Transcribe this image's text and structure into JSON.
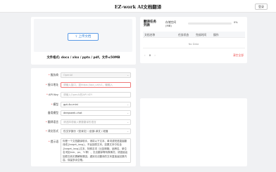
{
  "header": {
    "title": "EZ-work AI文档翻译",
    "login_label": "登录"
  },
  "upload": {
    "button_label": "上传文档",
    "formats_text": "文件格式: docx / xlsx / pptx / pdf，文件≤50MB"
  },
  "form": {
    "server": {
      "label": "服务商",
      "placeholder": "OpenAI"
    },
    "api_url": {
      "label": "接口地址",
      "placeholder": "请输入接口，如https://api_url/v1，输输入",
      "error_hint": "请输入接口地址"
    },
    "api_key": {
      "label": "API Key",
      "placeholder": "请输入OpenAI的API KEY"
    },
    "model": {
      "label": "模型",
      "value": "gpt-4o-mini"
    },
    "backup_model": {
      "label": "备用模型",
      "value": "deepseek-chat"
    },
    "target_lang": {
      "label": "翻译语言",
      "placeholder": "请选择或输入需要翻译的语言"
    },
    "output_format": {
      "label": "译文形式",
      "value": "仅文字部分（仅译文）/全部-译文 / 段落"
    },
    "prompt": {
      "label": "提示语",
      "value": "你是一个文档翻译助手，请将以下文本、单词或短语直接翻译成{target_lang}，不返回原文本。如果文本中包含{target_lang}文本、特殊名词（比如邮箱、品牌名、单位名词如mm、px、℃等）、无法翻译等特殊情况，请直接返回原文而无需解释原因。遇到无法翻译的文本直接返回原内容。保留多余空格。"
    }
  },
  "list": {
    "title": "翻译任务列表",
    "storage_label": "存储空间(MB)",
    "storage_percent": "0%",
    "columns": [
      "文档名称",
      "任务状态",
      "完成时间",
      "操作"
    ],
    "empty_text": "No Data",
    "pager_prev": "‹",
    "pager_page": "0",
    "pager_next": "›",
    "clear_label": "清空全部"
  }
}
